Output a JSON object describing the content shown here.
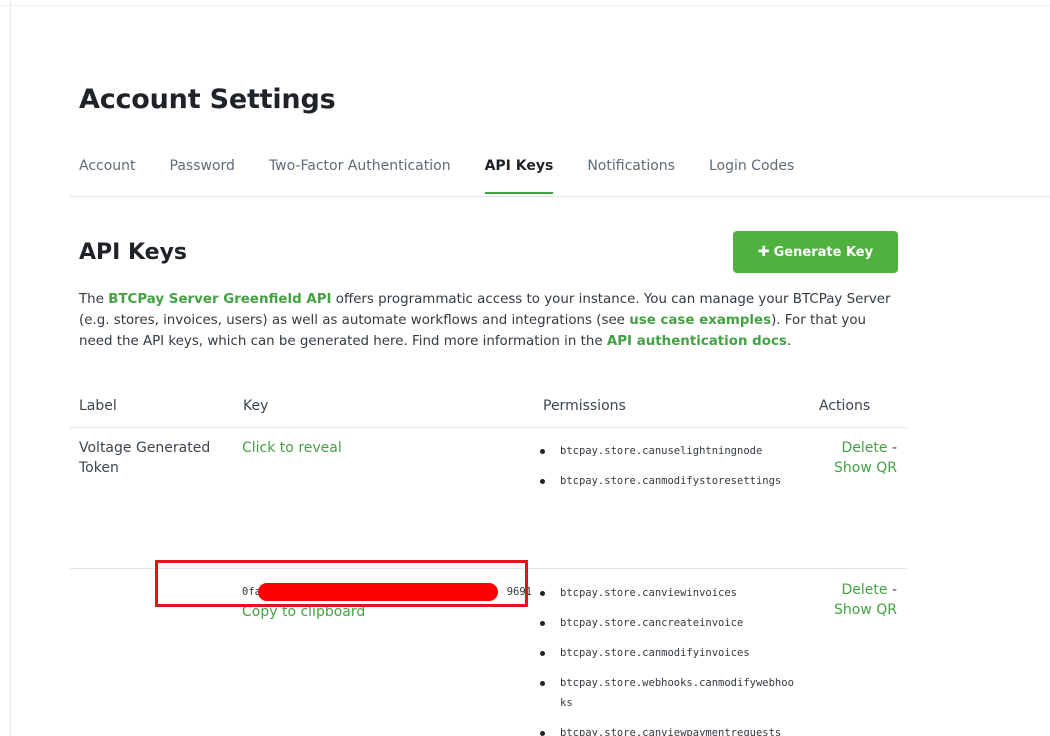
{
  "page": {
    "title": "Account Settings",
    "tabs": [
      {
        "label": "Account",
        "active": false
      },
      {
        "label": "Password",
        "active": false
      },
      {
        "label": "Two-Factor Authentication",
        "active": false
      },
      {
        "label": "API Keys",
        "active": true
      },
      {
        "label": "Notifications",
        "active": false
      },
      {
        "label": "Login Codes",
        "active": false
      }
    ]
  },
  "section": {
    "title": "API Keys",
    "generate_label": "Generate Key",
    "generate_icon": "plus-icon",
    "intro": {
      "p1": "The ",
      "link1": "BTCPay Server Greenfield API",
      "p2": " offers programmatic access to your instance. You can manage your BTCPay Server",
      "p3": "(e.g. stores, invoices, users) as well as automate workflows and integrations (see ",
      "link2": "use case examples",
      "p4": "). For that you",
      "p5": "need the API keys, which can be generated here. Find more information in the ",
      "link3": "API authentication docs",
      "p6": "."
    }
  },
  "table": {
    "headers": {
      "label": "Label",
      "key": "Key",
      "permissions": "Permissions",
      "actions": "Actions"
    },
    "rows": [
      {
        "label": "Voltage Generated Token",
        "key_link": "Click to reveal",
        "permissions": [
          "btcpay.store.canuselightningnode",
          "btcpay.store.canmodifystoresettings"
        ],
        "delete": "Delete",
        "dash": "-",
        "show_qr": "Show QR"
      },
      {
        "label": "",
        "key_prefix": "0fa",
        "key_suffix": "9691",
        "copy": "Copy to clipboard",
        "permissions": [
          "btcpay.store.canviewinvoices",
          "btcpay.store.cancreateinvoice",
          "btcpay.store.canmodifyinvoices",
          "btcpay.store.webhooks.canmodifywebhooks",
          "btcpay.store.canviewpaymentrequests"
        ],
        "delete": "Delete",
        "dash": "-",
        "show_qr": "Show QR"
      }
    ]
  },
  "colors": {
    "accent": "#44a244",
    "button": "#51b13e",
    "redaction": "#ff0000",
    "highlight_border": "#e8101a"
  }
}
